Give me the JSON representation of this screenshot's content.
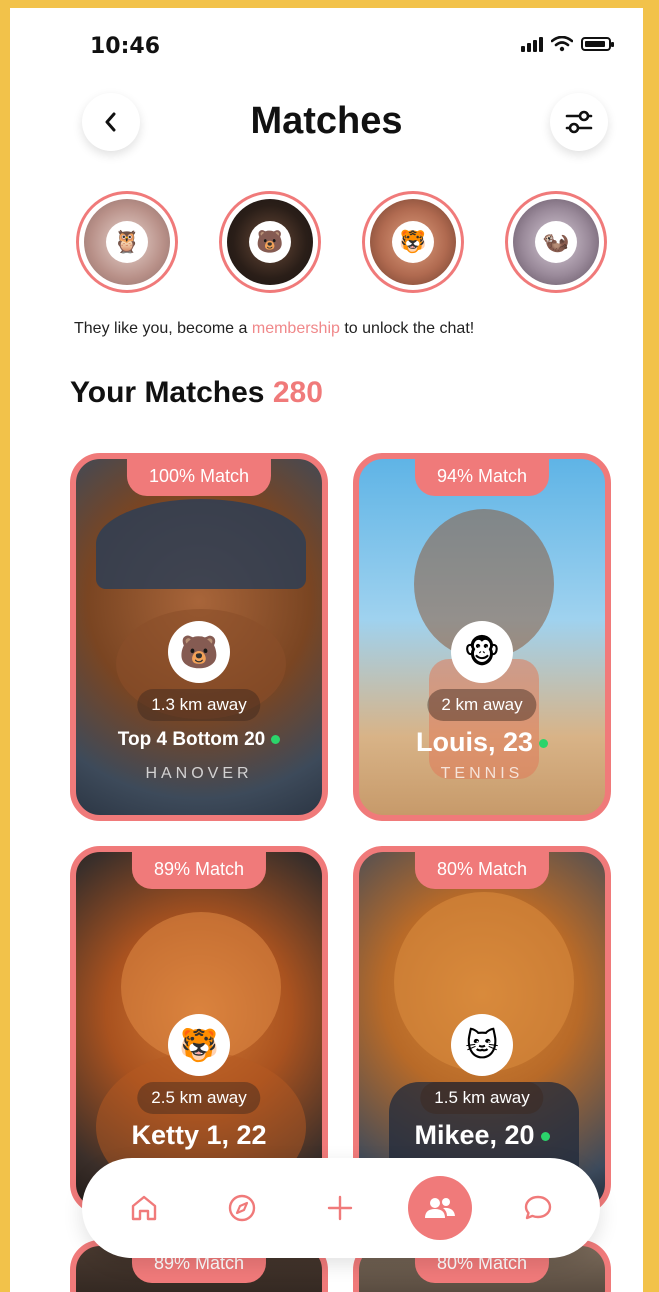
{
  "status_bar": {
    "time": "10:46"
  },
  "header": {
    "title": "Matches"
  },
  "stories": [
    {
      "emoji": "🦉",
      "bg": "#c9a9a2"
    },
    {
      "emoji": "🐻",
      "bg": "#3a2a22"
    },
    {
      "emoji": "🐯",
      "bg": "#b0705a"
    },
    {
      "emoji": "🦦",
      "bg": "#8a7b8a"
    }
  ],
  "notice": {
    "before": "They like you, become a ",
    "highlight": "membership",
    "after": " to unlock the chat!"
  },
  "section": {
    "title": "Your Matches",
    "count": "280"
  },
  "cards": [
    {
      "match": "100% Match",
      "emoji": "🐻",
      "distance": "1.3 km away",
      "name": "Top 4 Bottom 20",
      "subtitle": "HANOVER",
      "online": true
    },
    {
      "match": "94% Match",
      "emoji": "🐵",
      "distance": "2 km away",
      "name": "Louis, 23",
      "subtitle": "TENNIS",
      "online": true
    },
    {
      "match": "89% Match",
      "emoji": "🐯",
      "distance": "2.5 km away",
      "name": "Ketty 1, 22",
      "subtitle": "",
      "online": false
    },
    {
      "match": "80% Match",
      "emoji": "🐱",
      "distance": "1.5 km away",
      "name": "Mikee, 20",
      "subtitle": "",
      "online": true
    },
    {
      "match": "89% Match"
    },
    {
      "match": "80% Match"
    }
  ],
  "nav": {
    "items": [
      {
        "icon": "home-icon",
        "active": false
      },
      {
        "icon": "compass-icon",
        "active": false
      },
      {
        "icon": "plus-icon",
        "active": false
      },
      {
        "icon": "people-icon",
        "active": true
      },
      {
        "icon": "chat-icon",
        "active": false
      }
    ]
  },
  "colors": {
    "accent": "#f07a7a",
    "online": "#2bd46b",
    "frame": "#f2c24a"
  }
}
